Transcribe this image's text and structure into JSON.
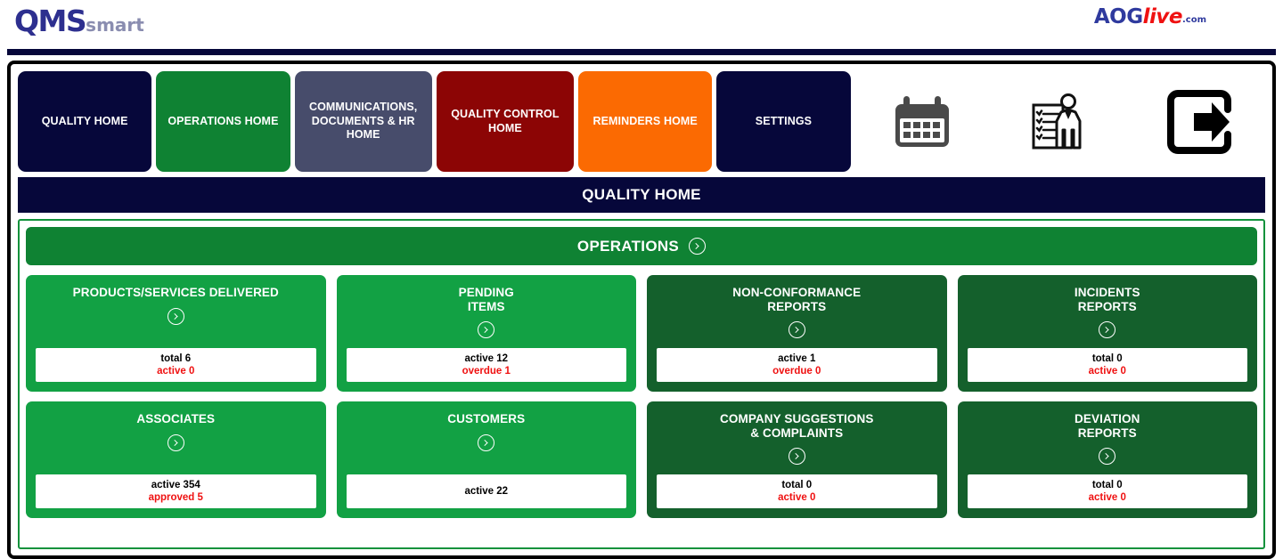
{
  "brand": {
    "qms_main": "QMS",
    "qms_sub": "smart",
    "aog_main": "AOG",
    "aog_live": "live",
    "aog_com": ".com"
  },
  "nav": {
    "buttons": [
      {
        "label": "QUALITY HOME",
        "color": "#06073a",
        "name": "nav-quality-home"
      },
      {
        "label": "OPERATIONS HOME",
        "color": "#0f8233",
        "name": "nav-operations-home"
      },
      {
        "label": "COMMUNICATIONS,\nDOCUMENTS & HR HOME",
        "color": "#474c6b",
        "name": "nav-communications-documents-hr-home"
      },
      {
        "label": "QUALITY CONTROL\nHOME",
        "color": "#8c0505",
        "name": "nav-quality-control-home"
      },
      {
        "label": "REMINDERS HOME",
        "color": "#fb6a02",
        "name": "nav-reminders-home"
      },
      {
        "label": "SETTINGS",
        "color": "#06073a",
        "name": "nav-settings"
      }
    ],
    "icons": [
      {
        "name": "calendar-icon",
        "label": "Calendar"
      },
      {
        "name": "auditor-checklist-icon",
        "label": "Auditor Checklist"
      },
      {
        "name": "logout-icon",
        "label": "Logout"
      }
    ]
  },
  "page": {
    "title": "QUALITY HOME"
  },
  "section": {
    "title": "OPERATIONS",
    "arrow_icon": "circle-right-arrow-icon"
  },
  "cards": [
    {
      "title": "PRODUCTS/SERVICES DELIVERED",
      "tone": "bright",
      "name": "card-products-services-delivered",
      "stat_primary": "total 6",
      "stat_secondary": "active 0"
    },
    {
      "title": "PENDING\nITEMS",
      "tone": "bright",
      "name": "card-pending-items",
      "stat_primary": "active 12",
      "stat_secondary": "overdue 1"
    },
    {
      "title": "NON-CONFORMANCE\nREPORTS",
      "tone": "dark",
      "name": "card-non-conformance-reports",
      "stat_primary": "active 1",
      "stat_secondary": "overdue 0"
    },
    {
      "title": "INCIDENTS\nREPORTS",
      "tone": "dark",
      "name": "card-incidents-reports",
      "stat_primary": "total 0",
      "stat_secondary": "active 0"
    },
    {
      "title": "ASSOCIATES",
      "tone": "bright",
      "name": "card-associates",
      "stat_primary": "active 354",
      "stat_secondary": "approved 5"
    },
    {
      "title": "CUSTOMERS",
      "tone": "bright",
      "name": "card-customers",
      "stat_primary": "active 22",
      "stat_secondary": ""
    },
    {
      "title": "COMPANY SUGGESTIONS\n& COMPLAINTS",
      "tone": "dark",
      "name": "card-company-suggestions-complaints",
      "stat_primary": "total 0",
      "stat_secondary": "active 0"
    },
    {
      "title": "DEVIATION\nREPORTS",
      "tone": "dark",
      "name": "card-deviation-reports",
      "stat_primary": "total 0",
      "stat_secondary": "active 0"
    }
  ],
  "colors": {
    "navy": "#06073a",
    "green_bright": "#12a144",
    "green_dark": "#14602c",
    "green_header": "#0f8233",
    "red": "#ef1111",
    "orange": "#fb6a02",
    "slate": "#474c6b",
    "maroon": "#8c0505"
  }
}
